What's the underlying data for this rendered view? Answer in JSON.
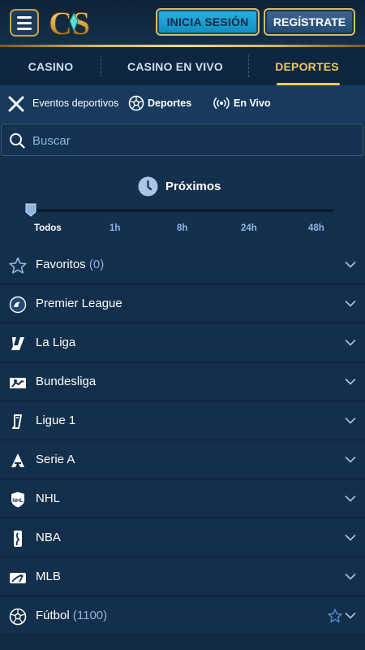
{
  "header": {
    "logo_text": "CS",
    "login_label": "INICIA SESIÓN",
    "register_label": "REGÍSTRATE"
  },
  "main_tabs": [
    {
      "label": "CASINO",
      "active": false
    },
    {
      "label": "CASINO EN VIVO",
      "active": false
    },
    {
      "label": "DEPORTES",
      "active": true
    }
  ],
  "subnav": {
    "label": "Eventos deportivos",
    "deportes": "Deportes",
    "en_vivo": "En Vivo"
  },
  "search": {
    "placeholder": "Buscar"
  },
  "time_filter": {
    "title": "Próximos",
    "options": [
      "Todos",
      "1h",
      "8h",
      "24h",
      "48h"
    ],
    "selected": "Todos"
  },
  "leagues": [
    {
      "name": "Favoritos",
      "count": "(0)",
      "icon": "star-icon"
    },
    {
      "name": "Premier League",
      "count": "",
      "icon": "premier-league-icon"
    },
    {
      "name": "La Liga",
      "count": "",
      "icon": "laliga-icon"
    },
    {
      "name": "Bundesliga",
      "count": "",
      "icon": "bundesliga-icon"
    },
    {
      "name": "Ligue 1",
      "count": "",
      "icon": "ligue1-icon"
    },
    {
      "name": "Serie A",
      "count": "",
      "icon": "serie-a-icon"
    },
    {
      "name": "NHL",
      "count": "",
      "icon": "nhl-icon"
    },
    {
      "name": "NBA",
      "count": "",
      "icon": "nba-icon"
    },
    {
      "name": "MLB",
      "count": "",
      "icon": "mlb-icon"
    },
    {
      "name": "Fútbol",
      "count": "(1100)",
      "icon": "soccer-ball-icon"
    }
  ],
  "colors": {
    "accent_gold": "#f0c75e",
    "login_blue": "#1ea0d4",
    "background": "#132f4c",
    "muted_text": "#8fb6de"
  }
}
